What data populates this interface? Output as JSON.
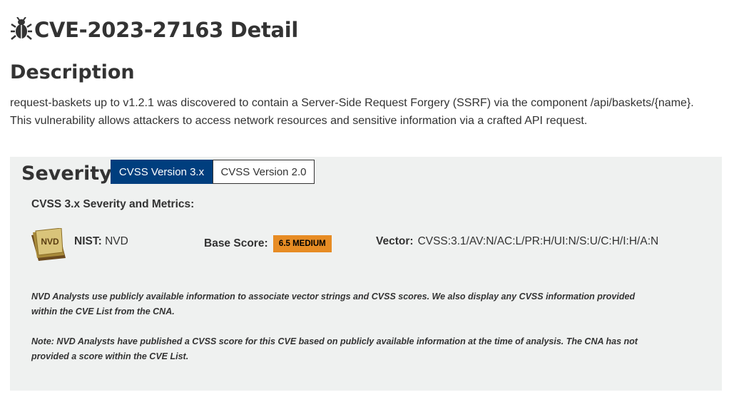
{
  "page": {
    "title": "CVE-2023-27163 Detail"
  },
  "description": {
    "heading": "Description",
    "text": "request-baskets up to v1.2.1 was discovered to contain a Server-Side Request Forgery (SSRF) via the component /api/baskets/{name}. This vulnerability allows attackers to access network resources and sensitive information via a crafted API request."
  },
  "severity": {
    "heading": "Severity",
    "tabs": [
      {
        "label": "CVSS Version 3.x",
        "active": true
      },
      {
        "label": "CVSS Version 2.0",
        "active": false
      }
    ],
    "metrics_heading": "CVSS 3.x Severity and Metrics:",
    "logo_text": "NVD",
    "nist_label": "NIST:",
    "nist_value": "NVD",
    "base_score_label": "Base Score:",
    "base_score_badge": "6.5 MEDIUM",
    "vector_label": "Vector:",
    "vector_value": "CVSS:3.1/AV:N/AC:L/PR:H/UI:N/S:U/C:H/I:H/A:N",
    "note1": "NVD Analysts use publicly available information to associate vector strings and CVSS scores. We also display any CVSS information provided within the CVE List from the CNA.",
    "note2": "Note: NVD Analysts have published a CVSS score for this CVE based on publicly available information at the time of analysis. The CNA has not provided a score within the CVE List."
  },
  "colors": {
    "active_tab": "#003e7e",
    "medium_badge": "#e78c24",
    "panel_bg": "#eff1f0",
    "text": "#333333"
  },
  "icons": {
    "title_icon": "bug-icon",
    "nvd_logo": "nvd-logo-icon"
  }
}
